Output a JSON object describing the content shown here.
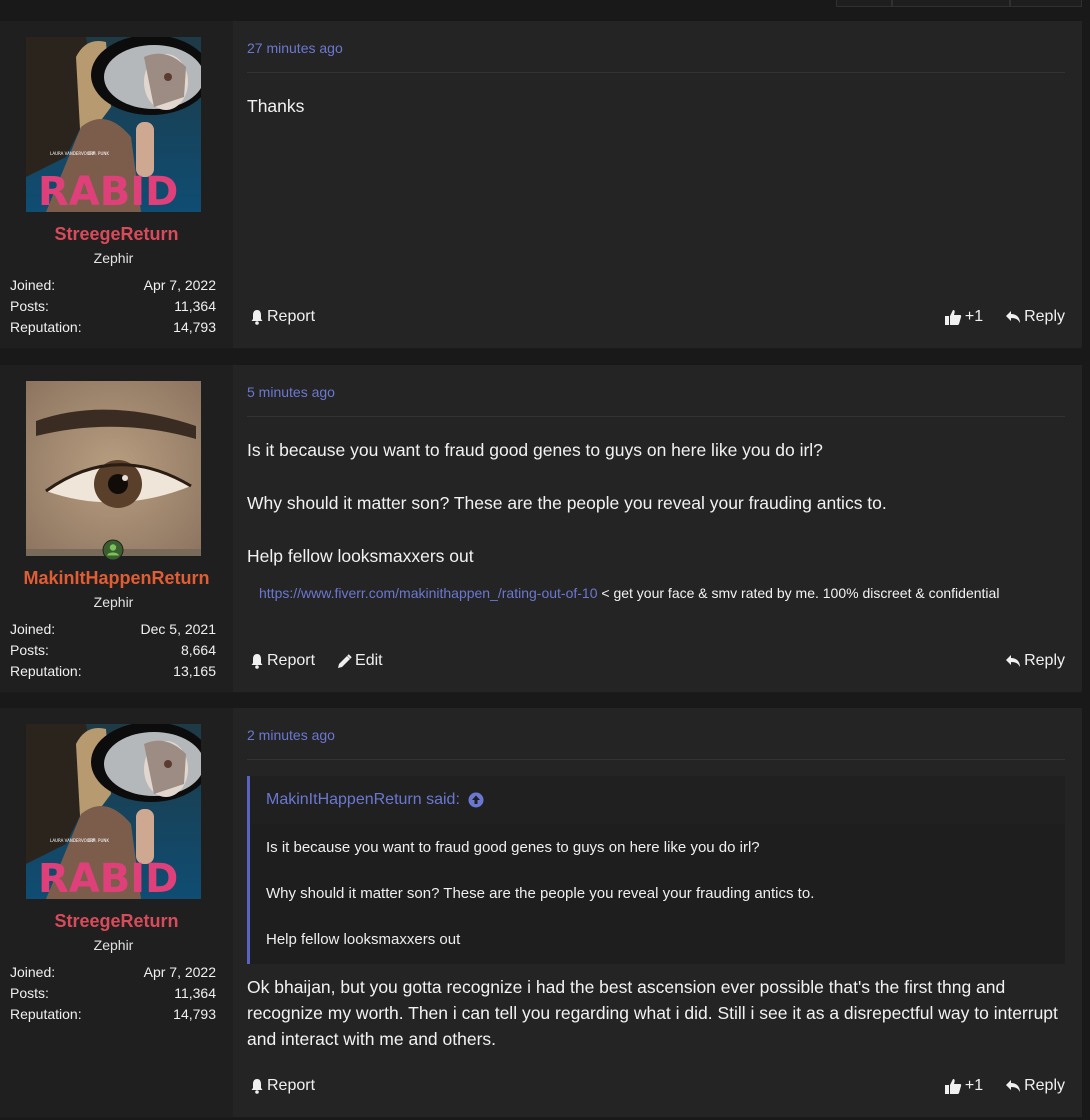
{
  "posts": [
    {
      "username": "StreegeReturn",
      "user_title": "Zephir",
      "joined_label": "Joined:",
      "joined": "Apr 7, 2022",
      "posts_label": "Posts:",
      "posts_count": "11,364",
      "reputation_label": "Reputation:",
      "reputation": "14,793",
      "time": "27 minutes ago",
      "body": [
        "Thanks"
      ],
      "actions": {
        "report": "Report",
        "like": "+1",
        "reply": "Reply"
      },
      "avatar_text": "RABID",
      "avatar_small_1": "LAURA VANDERVOORT",
      "avatar_small_2": "C.M. PUNK"
    },
    {
      "username": "MakinItHappenReturn",
      "user_title": "Zephir",
      "joined_label": "Joined:",
      "joined": "Dec 5, 2021",
      "posts_label": "Posts:",
      "posts_count": "8,664",
      "reputation_label": "Reputation:",
      "reputation": "13,165",
      "time": "5 minutes ago",
      "body": [
        "Is it because you want to fraud good genes to guys on here like you do irl?",
        "Why should it matter son? These are the people you reveal your frauding antics to.",
        "Help fellow looksmaxxers out"
      ],
      "signature_link": "https://www.fiverr.com/makinithappen_/rating-out-of-10",
      "signature_text": " < get your face & smv rated by me. 100% discreet & confidential",
      "actions": {
        "report": "Report",
        "edit": "Edit",
        "reply": "Reply"
      }
    },
    {
      "username": "StreegeReturn",
      "user_title": "Zephir",
      "joined_label": "Joined:",
      "joined": "Apr 7, 2022",
      "posts_label": "Posts:",
      "posts_count": "11,364",
      "reputation_label": "Reputation:",
      "reputation": "14,793",
      "time": "2 minutes ago",
      "quote": {
        "author": "MakinItHappenReturn said:",
        "lines": [
          "Is it because you want to fraud good genes to guys on here like you do irl?",
          "Why should it matter son? These are the people you reveal your frauding antics to.",
          "Help fellow looksmaxxers out"
        ]
      },
      "body": [
        "Ok bhaijan, but you gotta recognize i had the best ascension ever possible that's the first thng and recognize my worth. Then i can tell you regarding what i did. Still i see it as a disrepectful way to interrupt and interact with me and others."
      ],
      "actions": {
        "report": "Report",
        "like": "+1",
        "reply": "Reply"
      },
      "avatar_text": "RABID",
      "avatar_small_1": "LAURA VANDERVOORT",
      "avatar_small_2": "C.M. PUNK"
    }
  ],
  "colors": {
    "accent": "#6b78d1",
    "username_red": "#d84b5a",
    "username_orange": "#e05d35",
    "online": "#6aa84f"
  }
}
